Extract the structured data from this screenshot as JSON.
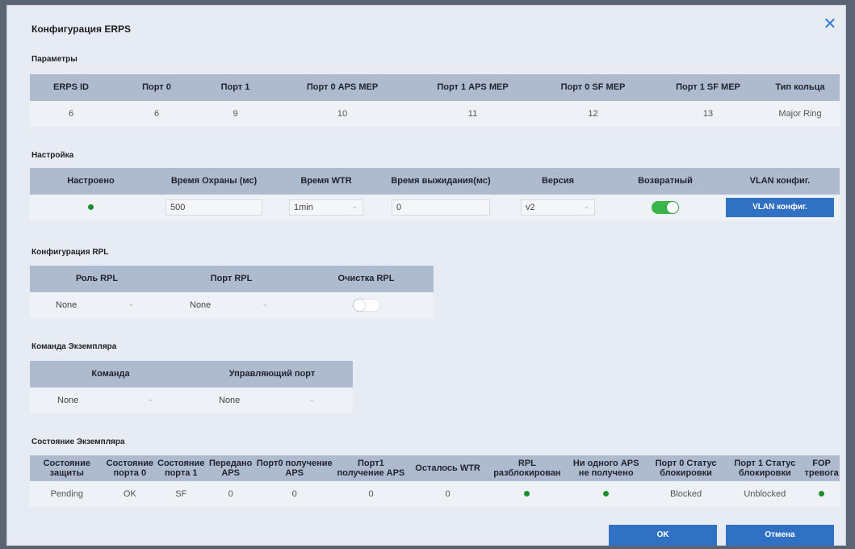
{
  "title": "Конфигурация ERPS",
  "params": {
    "section": "Параметры",
    "headers": [
      "ERPS ID",
      "Порт 0",
      "Порт 1",
      "Порт 0 APS MEP",
      "Порт 1 APS MEP",
      "Порт 0 SF MEP",
      "Порт 1 SF MEP",
      "Тип кольца"
    ],
    "values": [
      "6",
      "6",
      "9",
      "10",
      "11",
      "12",
      "13",
      "Major Ring"
    ]
  },
  "setup": {
    "section": "Настройка",
    "headers": [
      "Настроено",
      "Время Охраны (мс)",
      "Время WTR",
      "Время выжидания(мс)",
      "Версия",
      "Возвратный",
      "VLAN конфиг."
    ],
    "guard_time": "500",
    "wtr": "1min",
    "holdoff": "0",
    "version": "v2",
    "revertive": true,
    "vlan_button": "VLAN конфиг."
  },
  "rpl": {
    "section": "Конфигурация RPL",
    "headers": [
      "Роль RPL",
      "Порт RPL",
      "Очистка RPL"
    ],
    "role": "None",
    "port": "None",
    "clear": false
  },
  "command": {
    "section": "Команда Экземпляра",
    "headers": [
      "Команда",
      "Управляющий порт"
    ],
    "command": "None",
    "port": "None"
  },
  "state": {
    "section": "Состояние Экземпляра",
    "headers": [
      "Состояние защиты",
      "Состояние порта 0",
      "Состояние порта 1",
      "Передано APS",
      "Порт0 получение APS",
      "Порт1 получение APS",
      "Осталось WTR",
      "RPL разблокирован",
      "Ни одного APS не получено",
      "Порт 0 Статус блокировки",
      "Порт 1 Статус блокировки",
      "FOP тревога"
    ],
    "protection": "Pending",
    "port0": "OK",
    "port1": "SF",
    "tx_aps": "0",
    "rx_aps0": "0",
    "rx_aps1": "0",
    "wtr_left": "0",
    "port0_block": "Blocked",
    "port1_block": "Unblocked"
  },
  "buttons": {
    "ok": "OK",
    "cancel": "Отмена"
  },
  "colors": {
    "accent": "#3071c4",
    "header": "#aebacd",
    "ok_dot": "#1e8f2d",
    "toggle_on": "#3bb54a"
  }
}
